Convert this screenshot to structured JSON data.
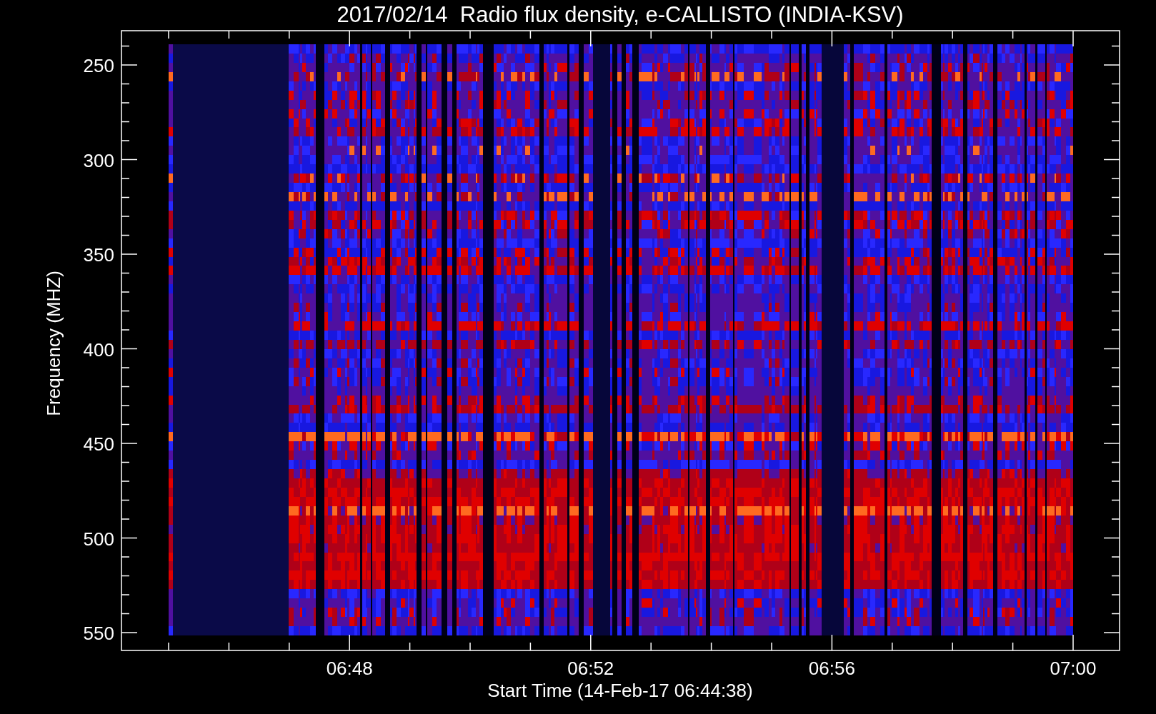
{
  "title": "2017/02/14  Radio flux density, e-CALLISTO (INDIA-KSV)",
  "plot": {
    "ylabel": "Frequency (MHZ)",
    "xlabel": "Start Time (14-Feb-17 06:44:38)",
    "yticks": [
      "250",
      "300",
      "350",
      "400",
      "450",
      "500",
      "550"
    ],
    "xticks": [
      "06:48",
      "06:52",
      "06:56",
      "07:00"
    ]
  }
}
